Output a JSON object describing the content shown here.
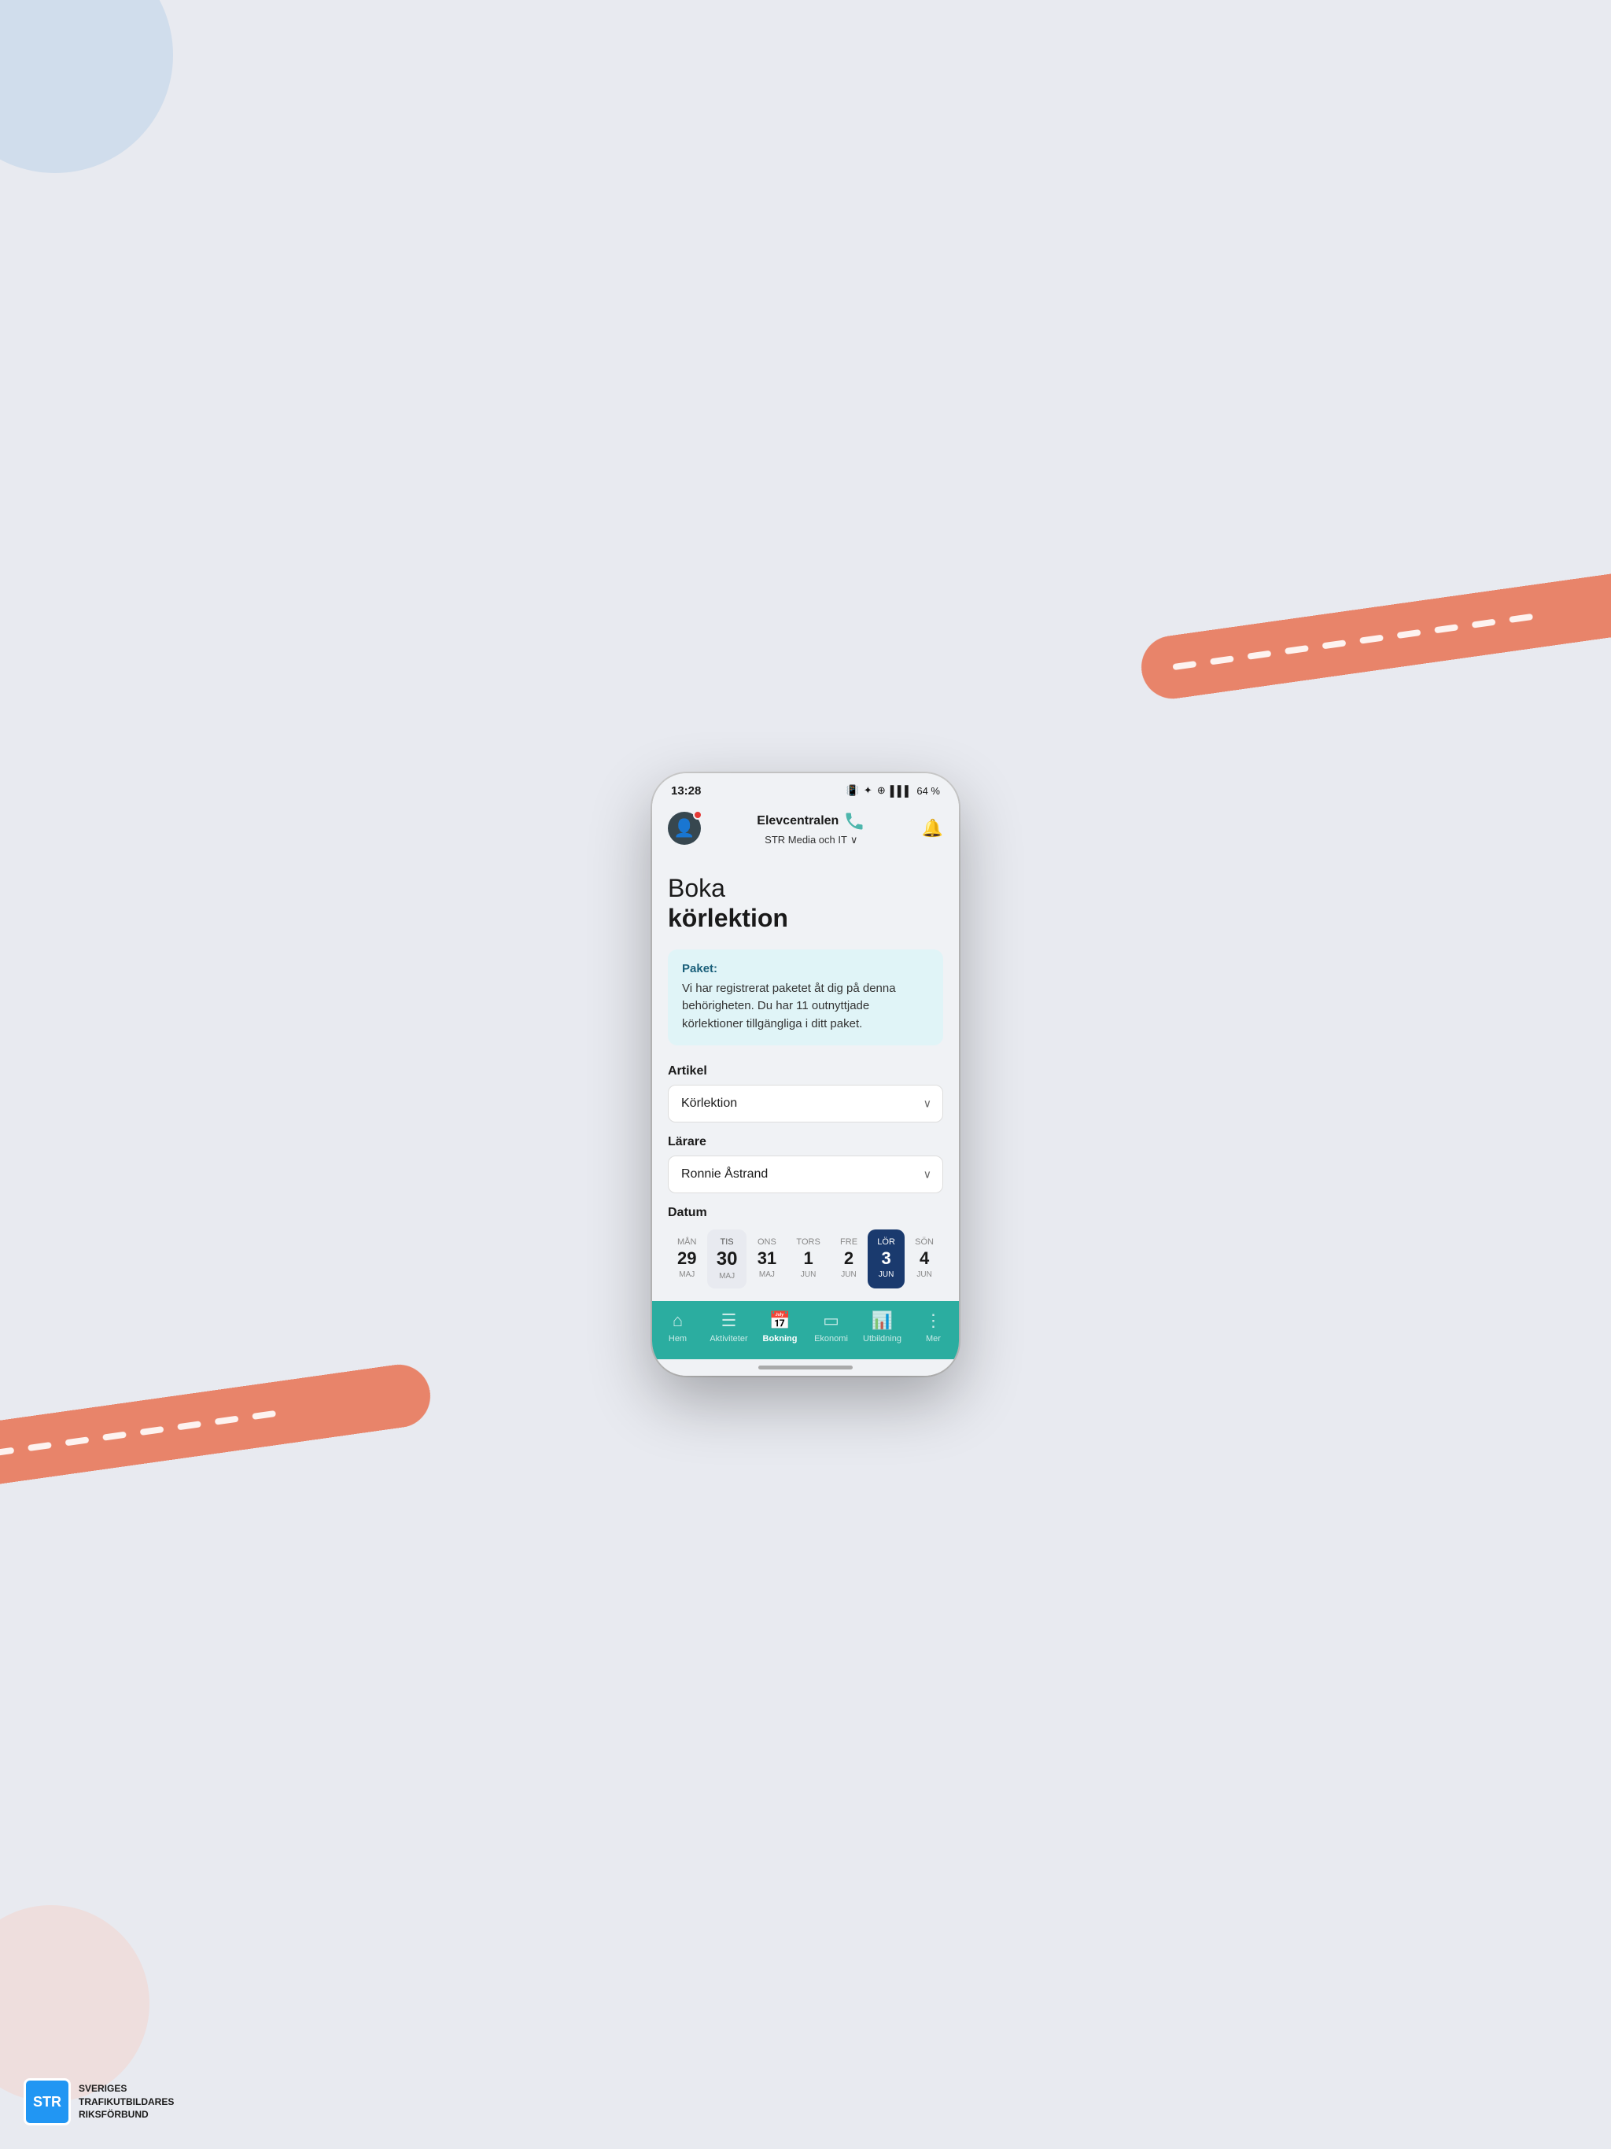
{
  "status_bar": {
    "time": "13:28",
    "battery": "64 %",
    "icons": "🔇 ✦ ⊕"
  },
  "header": {
    "brand": "Elevcentralen",
    "subtitle": "STR Media och IT",
    "chevron": "∨"
  },
  "page": {
    "title_light": "Boka",
    "title_bold": "körlektion"
  },
  "info_box": {
    "title": "Paket:",
    "text": "Vi har registrerat paketet åt dig på denna behörigheten. Du har 11 outnyttjade körlektioner tillgängliga i ditt paket."
  },
  "form": {
    "artikel_label": "Artikel",
    "artikel_value": "Körlektion",
    "larare_label": "Lärare",
    "larare_value": "Ronnie Åstrand",
    "datum_label": "Datum"
  },
  "dates": [
    {
      "day": "MÅN",
      "num": "29",
      "month": "MAJ",
      "active": false,
      "highlighted": false
    },
    {
      "day": "TIS",
      "num": "30",
      "month": "MAJ",
      "active": false,
      "highlighted": true
    },
    {
      "day": "ONS",
      "num": "31",
      "month": "MAJ",
      "active": false,
      "highlighted": false
    },
    {
      "day": "TORS",
      "num": "1",
      "month": "JUN",
      "active": false,
      "highlighted": false
    },
    {
      "day": "FRE",
      "num": "2",
      "month": "JUN",
      "active": false,
      "highlighted": false
    },
    {
      "day": "LÖR",
      "num": "3",
      "month": "JUN",
      "active": true,
      "highlighted": false
    },
    {
      "day": "SÖN",
      "num": "4",
      "month": "JUN",
      "active": false,
      "highlighted": false
    }
  ],
  "bottom_nav": [
    {
      "id": "hem",
      "label": "Hem",
      "icon": "⌂",
      "active": false
    },
    {
      "id": "aktiviteter",
      "label": "Aktiviteter",
      "icon": "📋",
      "active": false
    },
    {
      "id": "bokning",
      "label": "Bokning",
      "icon": "📅",
      "active": true
    },
    {
      "id": "ekonomi",
      "label": "Ekonomi",
      "icon": "💳",
      "active": false
    },
    {
      "id": "utbildning",
      "label": "Utbildning",
      "icon": "📊",
      "active": false
    },
    {
      "id": "mer",
      "label": "Mer",
      "icon": "⋮",
      "active": false
    }
  ],
  "str_logo": {
    "abbr": "STR",
    "line1": "SVERIGES",
    "line2": "TRAFIKUTBILDARES",
    "line3": "RIKSFÖRBUND"
  }
}
